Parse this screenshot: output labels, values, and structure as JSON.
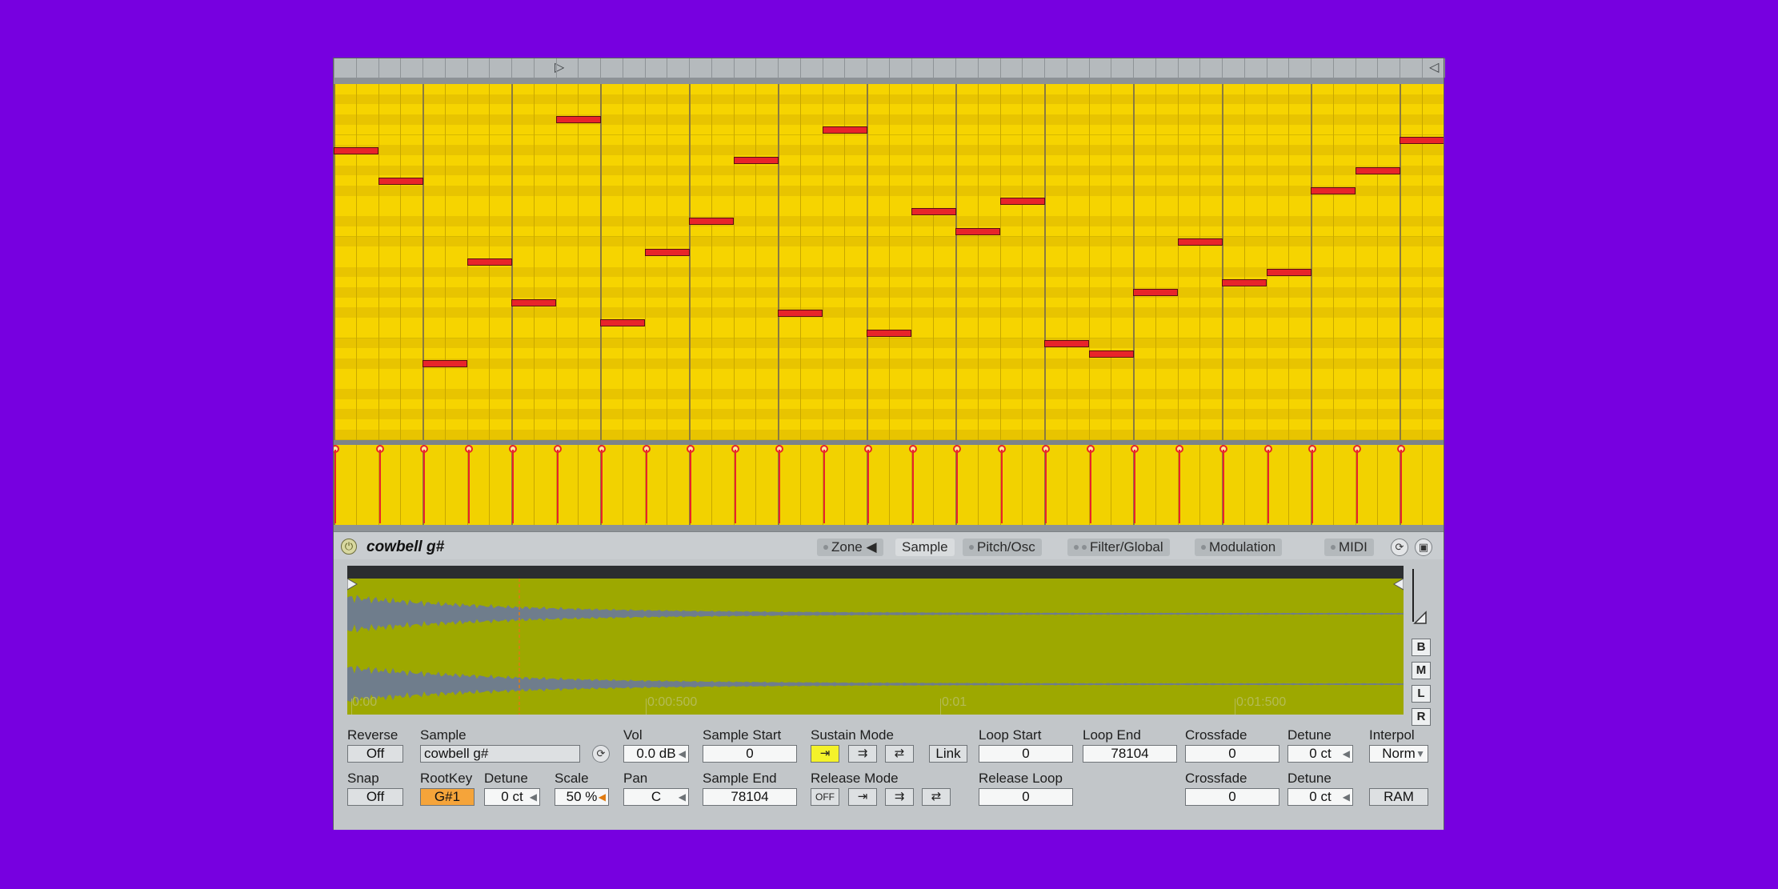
{
  "ruler": {
    "start_marker": "▷",
    "end_marker": "◁"
  },
  "piano_roll": {
    "notes": [
      {
        "col": 0,
        "row": 6.5
      },
      {
        "col": 1,
        "row": 9.5
      },
      {
        "col": 2,
        "row": 27.5
      },
      {
        "col": 3,
        "row": 17.5
      },
      {
        "col": 4,
        "row": 21.5
      },
      {
        "col": 5,
        "row": 3.5
      },
      {
        "col": 6,
        "row": 23.5
      },
      {
        "col": 7,
        "row": 16.5
      },
      {
        "col": 8,
        "row": 13.5
      },
      {
        "col": 9,
        "row": 7.5
      },
      {
        "col": 10,
        "row": 22.5
      },
      {
        "col": 11,
        "row": 4.5
      },
      {
        "col": 12,
        "row": 24.5
      },
      {
        "col": 13,
        "row": 12.5
      },
      {
        "col": 14,
        "row": 14.5
      },
      {
        "col": 15,
        "row": 11.5
      },
      {
        "col": 16,
        "row": 25.5
      },
      {
        "col": 17,
        "row": 26.5
      },
      {
        "col": 18,
        "row": 20.5
      },
      {
        "col": 19,
        "row": 15.5
      },
      {
        "col": 20,
        "row": 19.5
      },
      {
        "col": 21,
        "row": 18.5
      },
      {
        "col": 22,
        "row": 10.5
      },
      {
        "col": 23,
        "row": 8.5
      },
      {
        "col": 24,
        "row": 5.5
      }
    ]
  },
  "device": {
    "title": "cowbell g#",
    "tabs": [
      {
        "label": "Zone ◀",
        "active": false
      },
      {
        "label": "Sample",
        "active": true
      },
      {
        "label": "Pitch/Osc",
        "active": false
      },
      {
        "label": "Filter/Global",
        "active": false
      },
      {
        "label": "Modulation",
        "active": false
      },
      {
        "label": "MIDI",
        "active": false
      }
    ],
    "time_labels": [
      "0:00",
      "0:00:500",
      "0:01",
      "0:01:500"
    ],
    "side_buttons": [
      "B",
      "M",
      "L",
      "R"
    ],
    "controls": {
      "reverse": {
        "label": "Reverse",
        "value": "Off"
      },
      "snap": {
        "label": "Snap",
        "value": "Off"
      },
      "sample": {
        "label": "Sample",
        "value": "cowbell g#"
      },
      "rootkey": {
        "label": "RootKey",
        "value": "G#1"
      },
      "detune_small": {
        "label": "Detune",
        "value": "0 ct"
      },
      "vol": {
        "label": "Vol",
        "value": "0.0 dB"
      },
      "scale": {
        "label": "Scale",
        "value": "50 %"
      },
      "pan": {
        "label": "Pan",
        "value": "C"
      },
      "sample_start": {
        "label": "Sample Start",
        "value": "0"
      },
      "sample_end": {
        "label": "Sample End",
        "value": "78104"
      },
      "sustain_mode": {
        "label": "Sustain Mode"
      },
      "release_mode": {
        "label": "Release Mode",
        "off": "OFF"
      },
      "link": "Link",
      "loop_start": {
        "label": "Loop Start",
        "value": "0"
      },
      "loop_end": {
        "label": "Loop End",
        "value": "78104"
      },
      "release_loop": {
        "label": "Release Loop",
        "value": "0"
      },
      "crossfade1": {
        "label": "Crossfade",
        "value": "0"
      },
      "crossfade2": {
        "label": "Crossfade",
        "value": "0"
      },
      "detune1": {
        "label": "Detune",
        "value": "0 ct"
      },
      "detune2": {
        "label": "Detune",
        "value": "0 ct"
      },
      "interpol": {
        "label": "Interpol",
        "value": "Norm"
      },
      "ram": "RAM"
    }
  },
  "colors": {
    "background": "#7700e0",
    "roll_light": "#f6d400",
    "roll_dark": "#e8c400",
    "note": "#e8242a",
    "waveform_bg": "#9da800",
    "waveform": "#6f7d8c"
  }
}
